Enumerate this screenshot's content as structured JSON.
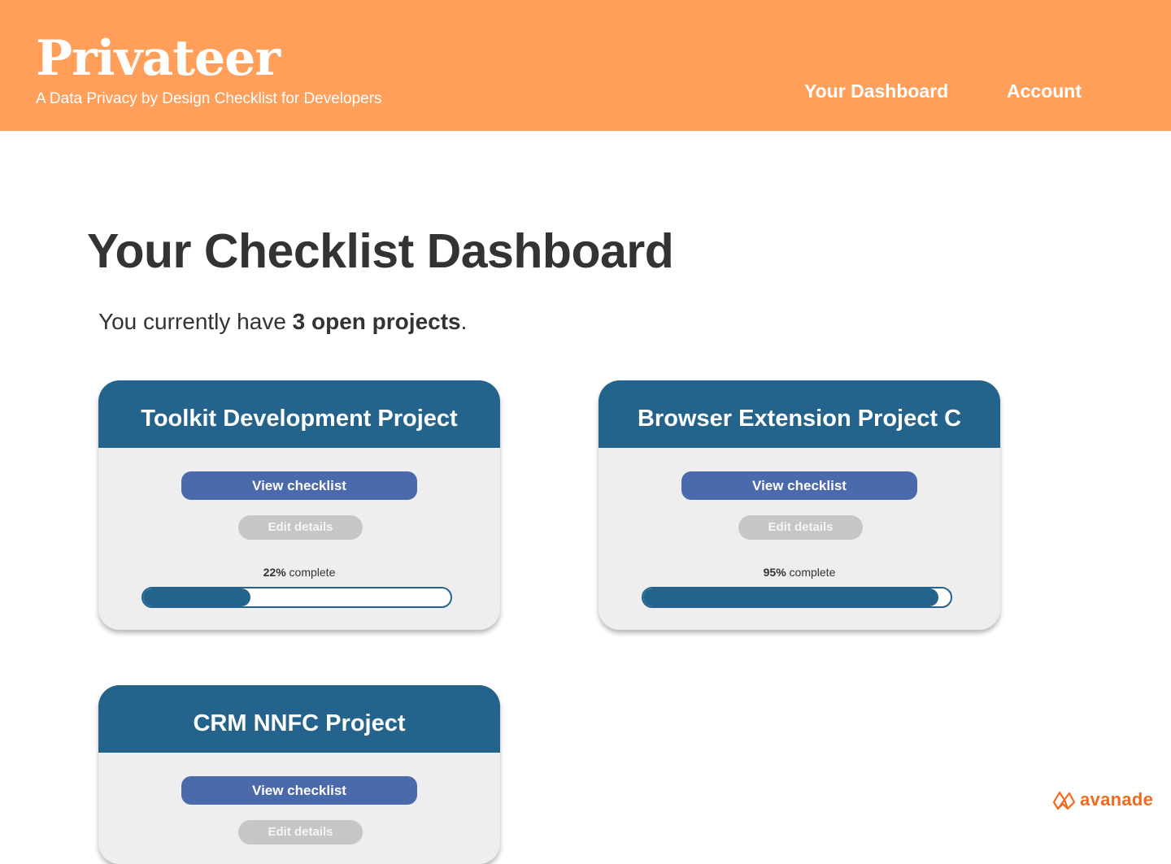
{
  "header": {
    "brand": "Privateer",
    "tagline": "A Data Privacy by Design Checklist for Developers",
    "nav": [
      {
        "label": "Your Dashboard"
      },
      {
        "label": "Account"
      }
    ],
    "background_color": "#ff9f5a"
  },
  "main": {
    "title": "Your Checklist Dashboard",
    "summary_prefix": "You currently have ",
    "summary_count": "3 open projects",
    "summary_suffix": "."
  },
  "projects": [
    {
      "title": "Toolkit Development Project",
      "view_label": "View checklist",
      "edit_label": "Edit details",
      "progress_label": "22%",
      "progress_suffix": " complete",
      "progress_value": 0.35
    },
    {
      "title": "Browser Extension Project C",
      "view_label": "View checklist",
      "edit_label": "Edit details",
      "progress_label": "95%",
      "progress_suffix": " complete",
      "progress_value": 0.96
    },
    {
      "title": "CRM NNFC Project",
      "view_label": "View checklist",
      "edit_label": "Edit details",
      "progress_label": "",
      "progress_suffix": "",
      "progress_value": 0
    }
  ],
  "footer": {
    "logo_text": "avanade",
    "logo_icon": "avanade-logo-icon"
  },
  "colors": {
    "accent": "#ff9f5a",
    "card_header": "#24638c",
    "primary_button": "#4a6aab",
    "secondary_button": "#c6c6c6",
    "logo": "#f06a1e"
  }
}
